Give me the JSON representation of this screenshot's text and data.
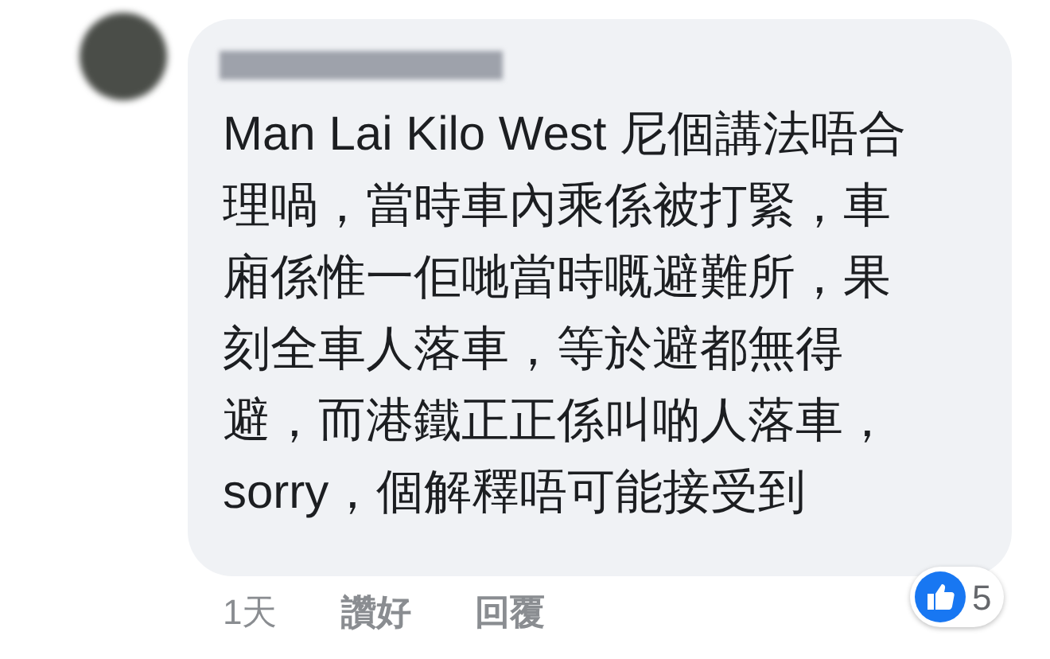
{
  "comment": {
    "lines": [
      "Man Lai Kilo West 尼個講法唔合",
      "理喎，當時車內乘係被打緊，車",
      "廂係惟一佢哋當時嘅避難所，果",
      "刻全車人落車，等於避都無得",
      "避，而港鐵正正係叫啲人落車，",
      "sorry，個解釋唔可能接受到"
    ]
  },
  "actions": [
    {
      "label": "1天",
      "kind": "time"
    },
    {
      "label": "讚好",
      "kind": "link"
    },
    {
      "label": "回覆",
      "kind": "link"
    }
  ],
  "reactions": {
    "count": "5"
  }
}
